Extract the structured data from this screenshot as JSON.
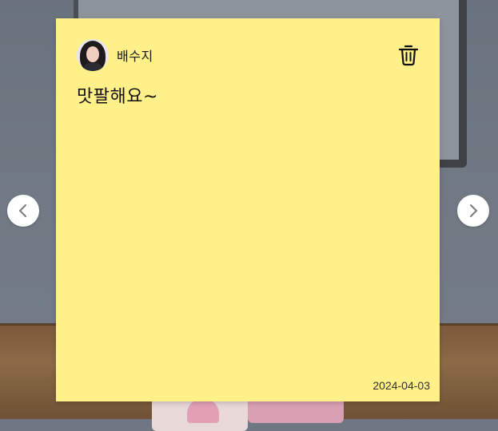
{
  "note": {
    "author": {
      "name": "배수지",
      "avatar_icon": "avatar-photo"
    },
    "content": "맛팔해요~",
    "date": "2024-04-03",
    "background_color": "#fff08a",
    "delete_icon": "trash-icon"
  },
  "navigation": {
    "prev_icon": "chevron-left-icon",
    "next_icon": "chevron-right-icon"
  }
}
